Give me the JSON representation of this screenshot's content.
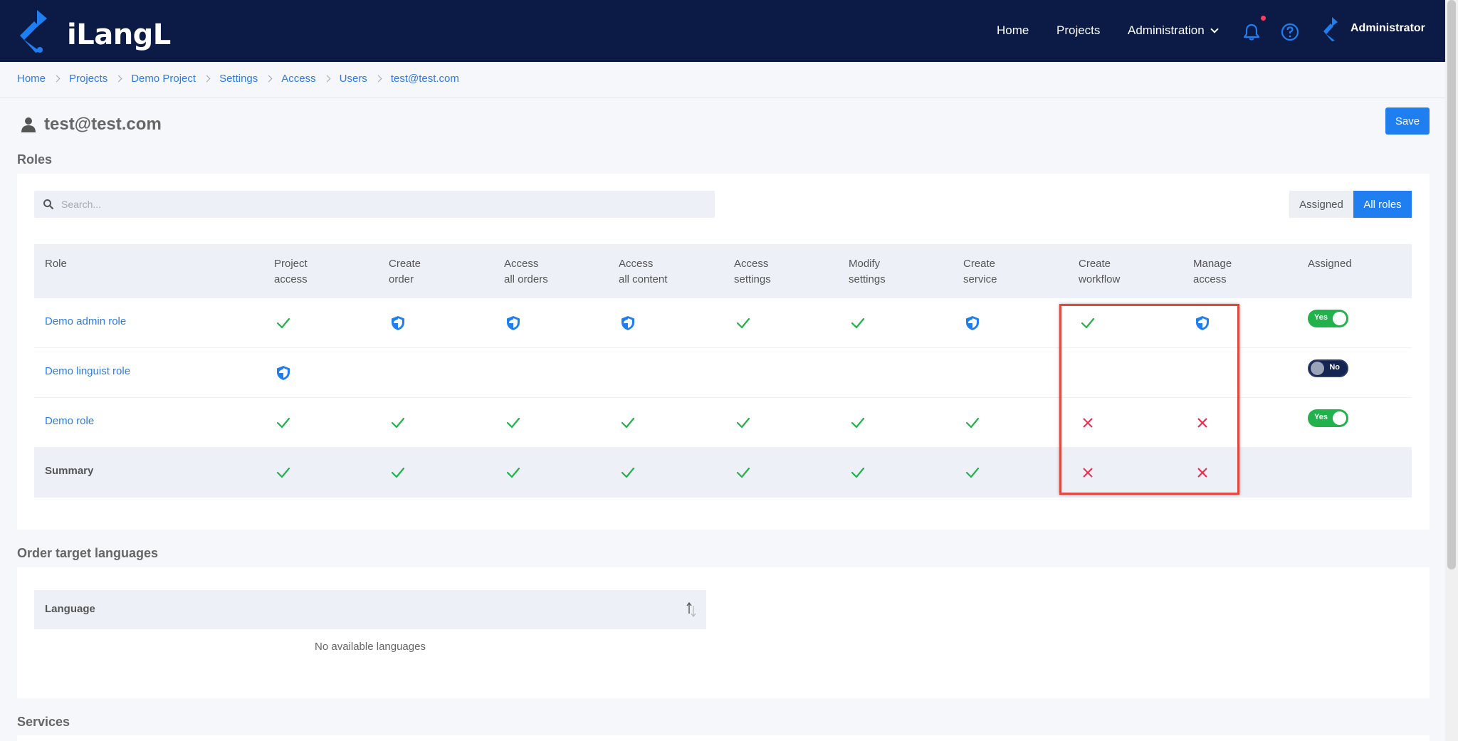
{
  "app": {
    "logo_text": "iLangL"
  },
  "nav": {
    "home": "Home",
    "projects": "Projects",
    "administration": "Administration",
    "user": "Administrator"
  },
  "breadcrumb": [
    "Home",
    "Projects",
    "Demo Project",
    "Settings",
    "Access",
    "Users",
    "test@test.com"
  ],
  "page": {
    "title": "test@test.com",
    "save_label": "Save"
  },
  "roles": {
    "section_title": "Roles",
    "search_placeholder": "Search...",
    "filter_assigned": "Assigned",
    "filter_all": "All roles",
    "filter_active": "All roles",
    "columns": [
      "Role",
      "Project\naccess",
      "Create\norder",
      "Access\nall orders",
      "Access\nall content",
      "Access\nsettings",
      "Modify\nsettings",
      "Create\nservice",
      "Create\nworkflow",
      "Manage\naccess",
      "Assigned"
    ],
    "rows": [
      {
        "name": "Demo admin role",
        "permissions": [
          "check",
          "shield",
          "shield",
          "shield",
          "check",
          "check",
          "shield",
          "check",
          "shield"
        ],
        "assigned": "Yes"
      },
      {
        "name": "Demo linguist role",
        "permissions": [
          "shield",
          "",
          "",
          "",
          "",
          "",
          "",
          "",
          ""
        ],
        "assigned": "No"
      },
      {
        "name": "Demo role",
        "permissions": [
          "check",
          "check",
          "check",
          "check",
          "check",
          "check",
          "check",
          "cross",
          "cross"
        ],
        "assigned": "Yes"
      }
    ],
    "summary": {
      "name": "Summary",
      "permissions": [
        "check",
        "check",
        "check",
        "check",
        "check",
        "check",
        "check",
        "cross",
        "cross"
      ]
    }
  },
  "languages": {
    "section_title": "Order target languages",
    "column": "Language",
    "empty": "No available languages"
  },
  "services": {
    "section_title": "Services"
  },
  "colors": {
    "header_bg": "#0c1b46",
    "accent": "#1f7ff0",
    "check": "#21b24b",
    "cross": "#f0284a",
    "highlight": "#e04a3d"
  }
}
